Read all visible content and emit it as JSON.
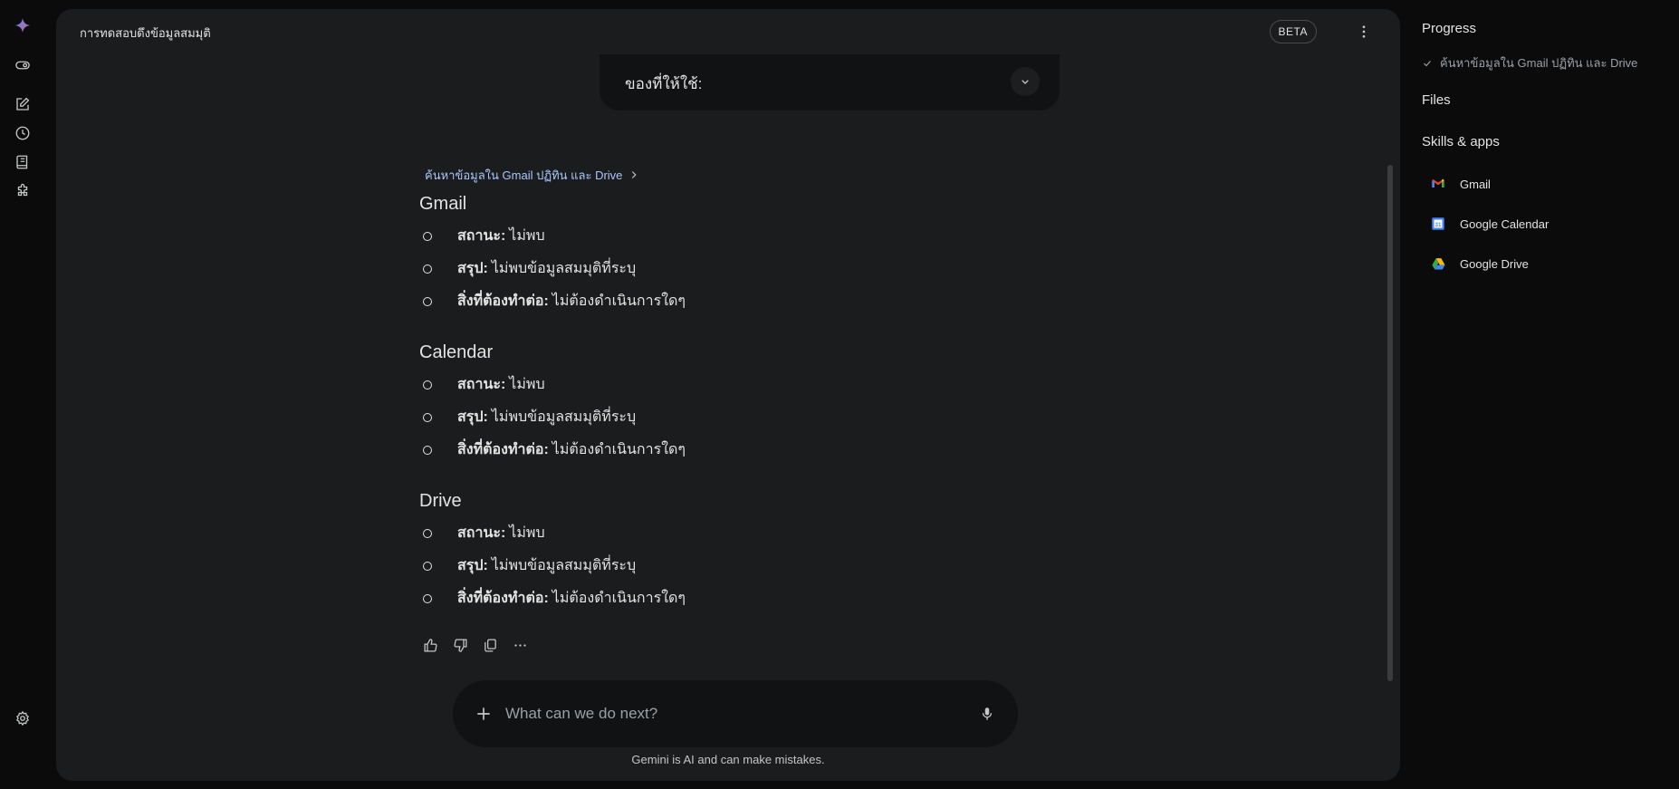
{
  "header": {
    "title": "การทดสอบดึงข้อมูลสมมุติ",
    "badge": "BETA"
  },
  "previous_card": {
    "label": "ของที่ให้ใช้:"
  },
  "response": {
    "breadcrumb": "ค้นหาข้อมูลใน Gmail ปฏิทิน และ Drive",
    "sections": [
      {
        "heading": "Gmail",
        "items": [
          {
            "label": "สถานะ:",
            "value": "ไม่พบ"
          },
          {
            "label": "สรุป:",
            "value": "ไม่พบข้อมูลสมมุติที่ระบุ"
          },
          {
            "label": "สิ่งที่ต้องทำต่อ:",
            "value": "ไม่ต้องดำเนินการใดๆ"
          }
        ]
      },
      {
        "heading": "Calendar",
        "items": [
          {
            "label": "สถานะ:",
            "value": "ไม่พบ"
          },
          {
            "label": "สรุป:",
            "value": "ไม่พบข้อมูลสมมุติที่ระบุ"
          },
          {
            "label": "สิ่งที่ต้องทำต่อ:",
            "value": "ไม่ต้องดำเนินการใดๆ"
          }
        ]
      },
      {
        "heading": "Drive",
        "items": [
          {
            "label": "สถานะ:",
            "value": "ไม่พบ"
          },
          {
            "label": "สรุป:",
            "value": "ไม่พบข้อมูลสมมุติที่ระบุ"
          },
          {
            "label": "สิ่งที่ต้องทำต่อ:",
            "value": "ไม่ต้องดำเนินการใดๆ"
          }
        ]
      }
    ],
    "actions": [
      "thumbs-up-icon",
      "thumbs-down-icon",
      "copy-icon",
      "more-horizontal-icon"
    ]
  },
  "composer": {
    "placeholder": "What can we do next?",
    "disclaimer": "Gemini is AI and can make mistakes."
  },
  "side_panel": {
    "progress_title": "Progress",
    "progress_steps": [
      {
        "label": "ค้นหาข้อมูลใน Gmail ปฏิทิน และ Drive",
        "done": true
      }
    ],
    "files_title": "Files",
    "skills_title": "Skills & apps",
    "apps": [
      {
        "name": "Gmail",
        "icon": "gmail-icon"
      },
      {
        "name": "Google Calendar",
        "icon": "google-calendar-icon"
      },
      {
        "name": "Google Drive",
        "icon": "google-drive-icon"
      }
    ]
  },
  "rail_icons": [
    "gemini-logo-icon",
    "toggle-icon",
    "new-chat-icon",
    "history-icon",
    "notebook-icon",
    "extensions-icon",
    "settings-icon"
  ],
  "colors": {
    "background": "#0b0b0c",
    "surface": "#1b1c1d",
    "card": "#111213",
    "text": "#e3e3e3",
    "link": "#a8c7fa"
  }
}
